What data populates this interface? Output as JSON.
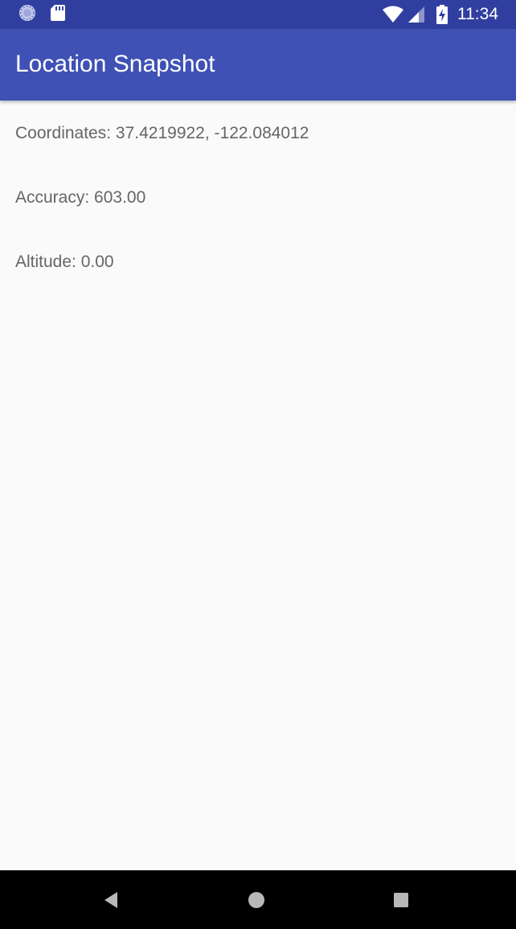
{
  "status_bar": {
    "time": "11:34",
    "icons": {
      "left": [
        "sync-icon",
        "sd-card-icon"
      ],
      "right": [
        "wifi-icon",
        "cellular-signal-icon",
        "battery-charging-icon"
      ]
    },
    "background_color": "#303f9f"
  },
  "app_bar": {
    "title": "Location Snapshot",
    "background_color": "#3f51b5"
  },
  "content": {
    "coordinates": "Coordinates: 37.4219922, -122.084012",
    "accuracy": "Accuracy: 603.00",
    "altitude": "Altitude: 0.00",
    "text_color": "#666666"
  },
  "nav_bar": {
    "buttons": [
      "back-icon",
      "home-icon",
      "recents-icon"
    ],
    "background_color": "#000000"
  }
}
